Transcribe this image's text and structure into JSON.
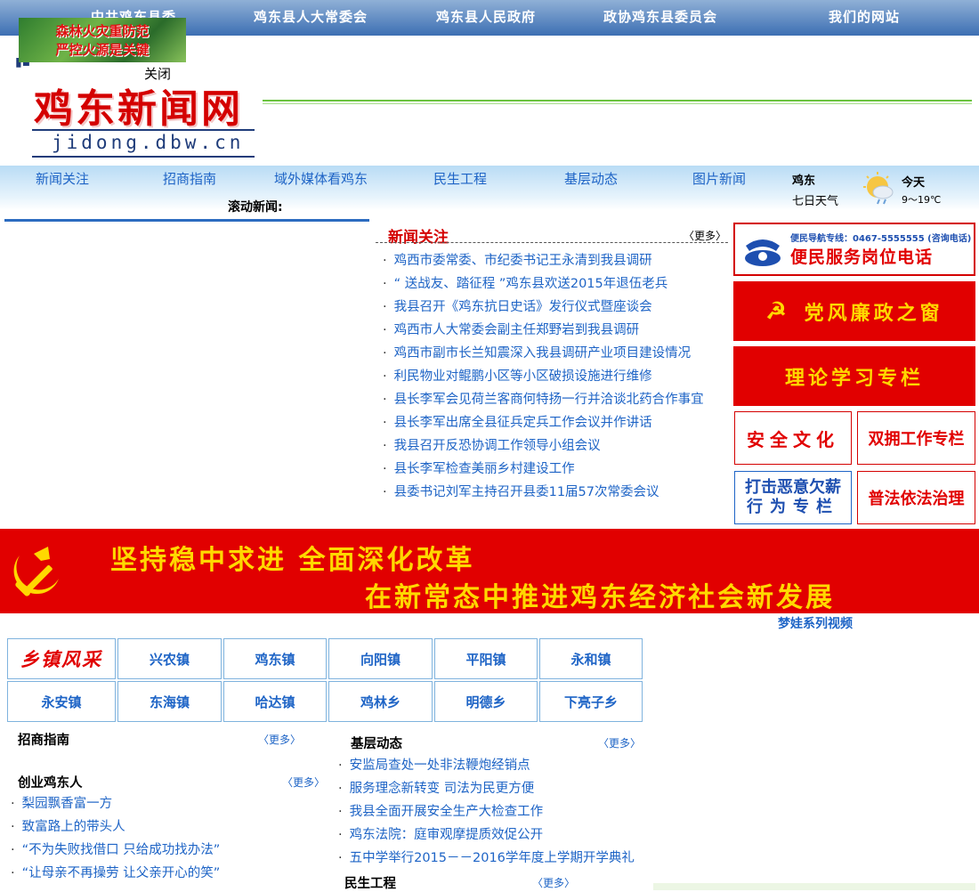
{
  "top_nav": {
    "items": [
      "中共鸡东县委",
      "鸡东县人大常委会",
      "鸡东县人民政府",
      "政协鸡东县委员会",
      "我们的网站"
    ]
  },
  "float_ad": {
    "line1": "森林火灾重防范",
    "line2": "严控火源是关键",
    "close_label": "关闭"
  },
  "logo": {
    "title": "鸡东新闻网",
    "domain": "jidong.dbw.cn"
  },
  "sub_nav": {
    "items": [
      "新闻关注",
      "招商指南",
      "域外媒体看鸡东",
      "民生工程",
      "基层动态",
      "图片新闻"
    ]
  },
  "weather": {
    "city": "鸡东",
    "week_label": "七日天气",
    "today_label": "今天",
    "temp": "9～19℃",
    "icon": "partly-cloudy-rain-icon"
  },
  "scroll_news": {
    "label": "滚动新闻:"
  },
  "news_focus": {
    "title": "新闻关注",
    "more": "〈更多〉",
    "items": [
      "鸡西市委常委、市纪委书记王永清到我县调研",
      "“  送战友、踏征程  ”鸡东县欢送2015年退伍老兵",
      "我县召开《鸡东抗日史话》发行仪式暨座谈会",
      "鸡西市人大常委会副主任郑野岩到我县调研",
      "鸡西市副市长兰知震深入我县调研产业项目建设情况",
      "利民物业对鲲鹏小区等小区破损设施进行维修",
      "县长李军会见荷兰客商何特扬一行并洽谈北药合作事宜",
      "县长李军出席全县征兵定兵工作会议并作讲话",
      "我县召开反恐协调工作领导小组会议",
      "县长李军检查美丽乡村建设工作",
      "县委书记刘军主持召开县委11届57次常委会议"
    ]
  },
  "side_banners": {
    "hotline_top": "便民导航专线：0467-5555555 (咨询电话)",
    "hotline_main": "便民服务岗位电话",
    "dangfeng": "党风廉政之窗",
    "lilun": "理论学习专栏",
    "anquan": "安全文化",
    "shuangyong": "双拥工作专栏",
    "daji_line1": "打击恶意欠薪",
    "daji_line2": "行为专栏",
    "pufa": "普法依法治理"
  },
  "big_banner": {
    "line1": "坚持稳中求进  全面深化改革",
    "line2": "在新常态中推进鸡东经济社会新发展"
  },
  "video_link": "梦娃系列视频",
  "towns": {
    "header": "乡镇风采",
    "row1": [
      "兴农镇",
      "鸡东镇",
      "向阳镇",
      "平阳镇",
      "永和镇"
    ],
    "row2": [
      "永安镇",
      "东海镇",
      "哈达镇",
      "鸡林乡",
      "明德乡",
      "下亮子乡"
    ]
  },
  "investment": {
    "title": "招商指南",
    "more": "〈更多〉"
  },
  "entrepreneurs": {
    "title": "创业鸡东人",
    "more": "〈更多〉",
    "items": [
      "梨园飘香富一方",
      "致富路上的带头人",
      "“不为失败找借口  只给成功找办法”",
      "“让母亲不再操劳  让父亲开心的笑”"
    ]
  },
  "grassroots": {
    "title": "基层动态",
    "more": "〈更多〉",
    "items": [
      "安监局查处一处非法鞭炮经销点",
      "服务理念新转变  司法为民更方便",
      "我县全面开展安全生产大检查工作",
      "鸡东法院：庭审观摩提质效促公开",
      "五中学举行2015－－2016学年度上学期开学典礼"
    ]
  },
  "livelihood": {
    "title": "民生工程",
    "more": "〈更多〉"
  },
  "colors": {
    "nav_blue": "#3d6fb3",
    "link_blue": "#1e64c6",
    "party_red": "#e10000",
    "gold": "#ffd800"
  }
}
